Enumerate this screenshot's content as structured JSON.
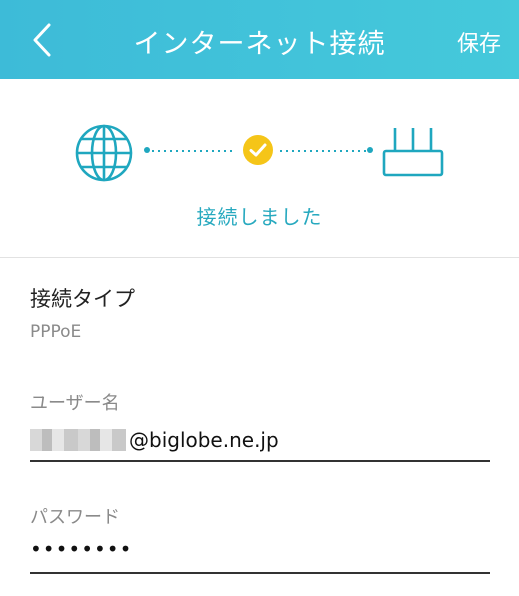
{
  "header": {
    "title": "インターネット接続",
    "save_label": "保存"
  },
  "status": {
    "text": "接続しました",
    "accent_color": "#1fa7bf",
    "check_color": "#f5c518"
  },
  "connection_type": {
    "label": "接続タイプ",
    "value": "PPPoE"
  },
  "username": {
    "label": "ユーザー名",
    "value": "@biglobe.ne.jp"
  },
  "password": {
    "label": "パスワード",
    "value": "••••••••"
  }
}
